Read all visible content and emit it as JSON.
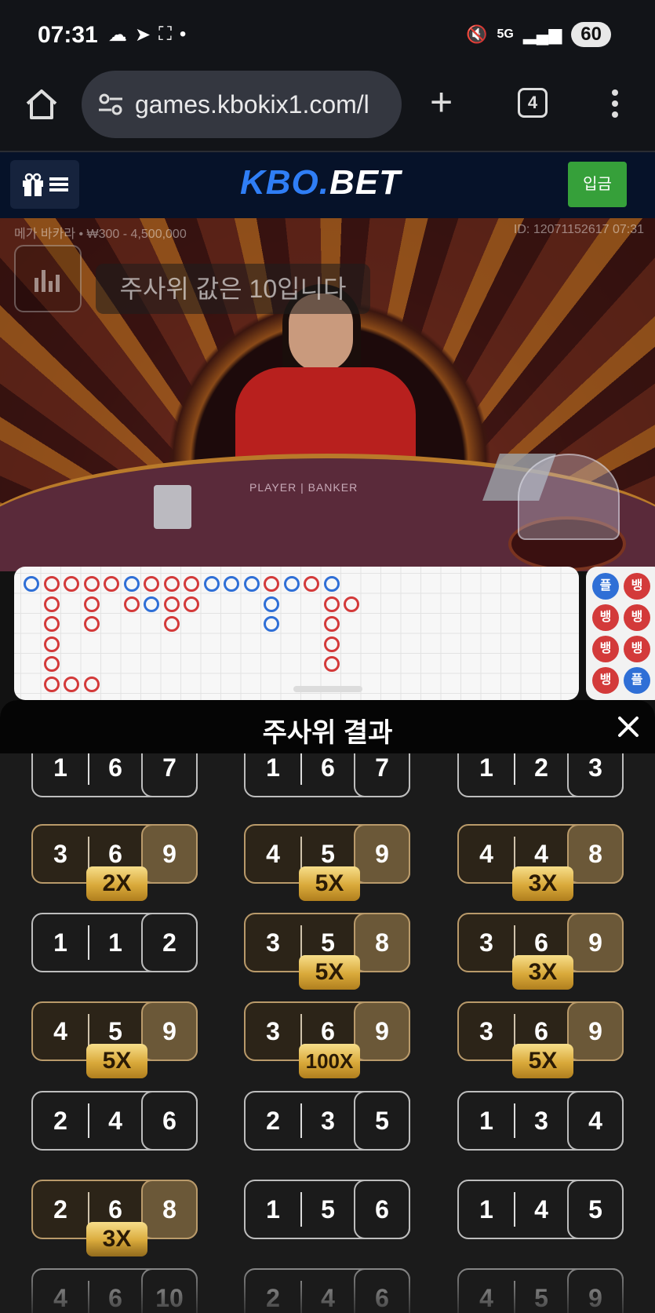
{
  "status_bar": {
    "time": "07:31",
    "network": "5G",
    "battery": "60"
  },
  "browser": {
    "url": "games.kbokix1.com/l",
    "tab_count": "4"
  },
  "site_header": {
    "logo_part1": "KBO.",
    "logo_part2": "BET",
    "deposit_label": "입금"
  },
  "video": {
    "game_info": "메가 바카라 • ₩300 - 4,500,000",
    "round_id": "ID: 12071152617 07:31",
    "toast": "주사위 값은 10입니다",
    "table_text": "PLAYER | BANKER"
  },
  "side_road": {
    "chips": [
      "플",
      "뱅",
      "뱅",
      "뱅",
      "뱅",
      "뱅",
      "뱅",
      "플"
    ]
  },
  "panel": {
    "title": "주사위 결과",
    "results": [
      {
        "dice": [
          "1",
          "6",
          "7"
        ],
        "multiplier": ""
      },
      {
        "dice": [
          "1",
          "6",
          "7"
        ],
        "multiplier": ""
      },
      {
        "dice": [
          "1",
          "2",
          "3"
        ],
        "multiplier": ""
      },
      {
        "dice": [
          "3",
          "6",
          "9"
        ],
        "multiplier": "2X"
      },
      {
        "dice": [
          "4",
          "5",
          "9"
        ],
        "multiplier": "5X"
      },
      {
        "dice": [
          "4",
          "4",
          "8"
        ],
        "multiplier": "3X"
      },
      {
        "dice": [
          "1",
          "1",
          "2"
        ],
        "multiplier": ""
      },
      {
        "dice": [
          "3",
          "5",
          "8"
        ],
        "multiplier": "5X"
      },
      {
        "dice": [
          "3",
          "6",
          "9"
        ],
        "multiplier": "3X"
      },
      {
        "dice": [
          "4",
          "5",
          "9"
        ],
        "multiplier": "5X"
      },
      {
        "dice": [
          "3",
          "6",
          "9"
        ],
        "multiplier": "100X"
      },
      {
        "dice": [
          "3",
          "6",
          "9"
        ],
        "multiplier": "5X"
      },
      {
        "dice": [
          "2",
          "4",
          "6"
        ],
        "multiplier": ""
      },
      {
        "dice": [
          "2",
          "3",
          "5"
        ],
        "multiplier": ""
      },
      {
        "dice": [
          "1",
          "3",
          "4"
        ],
        "multiplier": ""
      },
      {
        "dice": [
          "2",
          "6",
          "8"
        ],
        "multiplier": "3X"
      },
      {
        "dice": [
          "1",
          "5",
          "6"
        ],
        "multiplier": ""
      },
      {
        "dice": [
          "1",
          "4",
          "5"
        ],
        "multiplier": ""
      },
      {
        "dice": [
          "4",
          "6",
          "10"
        ],
        "multiplier": ""
      },
      {
        "dice": [
          "2",
          "4",
          "6"
        ],
        "multiplier": ""
      },
      {
        "dice": [
          "4",
          "5",
          "9"
        ],
        "multiplier": ""
      }
    ]
  },
  "colors": {
    "player": "#2f6fd6",
    "banker": "#d33a3a",
    "gold_card": "#6b5838",
    "deposit": "#36a03a"
  },
  "icons": [
    "cloud-icon",
    "telegram-icon",
    "screenshot-icon",
    "mute-icon",
    "signal-icon",
    "home-icon",
    "site-settings-icon",
    "new-tab-icon",
    "more-vert-icon",
    "gift-icon",
    "hamburger-icon",
    "stats-icon",
    "close-icon"
  ]
}
